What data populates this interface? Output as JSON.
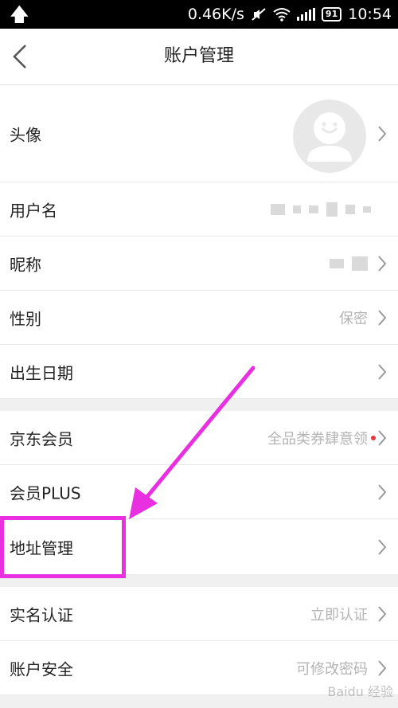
{
  "status_bar": {
    "speed": "0.46K/s",
    "battery": "91",
    "time": "10:54"
  },
  "nav": {
    "title": "账户管理"
  },
  "rows": [
    {
      "label": "头像",
      "value": ""
    },
    {
      "label": "用户名",
      "value": ""
    },
    {
      "label": "昵称",
      "value": ""
    },
    {
      "label": "性别",
      "value": "保密"
    },
    {
      "label": "出生日期",
      "value": ""
    },
    {
      "label": "京东会员",
      "value": "全品类券肆意领"
    },
    {
      "label": "会员PLUS",
      "value": ""
    },
    {
      "label": "地址管理",
      "value": ""
    },
    {
      "label": "实名认证",
      "value": "立即认证"
    },
    {
      "label": "账户安全",
      "value": "可修改密码"
    }
  ],
  "watermark": "Baidu 经验",
  "colors": {
    "highlight": "#e830e0",
    "badge": "#e4393c"
  },
  "icons": [
    "up-arrow-icon",
    "mute-icon",
    "wifi-icon",
    "signal-icon",
    "battery-icon",
    "back-icon",
    "chevron-right-icon",
    "avatar-icon"
  ]
}
